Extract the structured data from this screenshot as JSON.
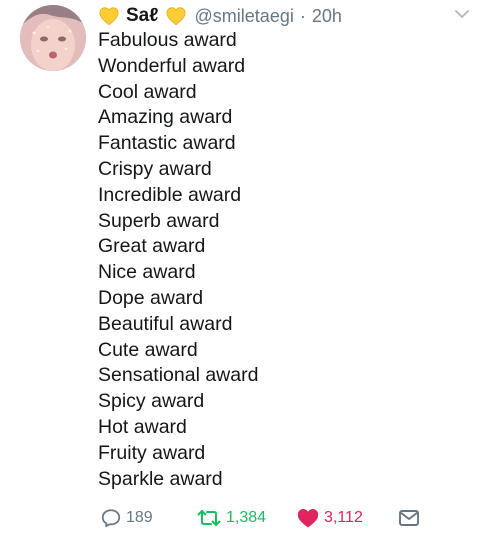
{
  "tweet": {
    "display_name": "Saℓ",
    "handle": "@smiletaegi",
    "separator": "·",
    "time": "20h",
    "lines": [
      "Fabulous award",
      "Wonderful award",
      "Cool award",
      "Amazing award",
      "Fantastic award",
      "Crispy award",
      "Incredible award",
      "Superb award",
      "Great award",
      "Nice award",
      "Dope award",
      "Beautiful award",
      "Cute award",
      "Sensational award",
      "Spicy award",
      "Hot award",
      "Fruity award",
      "Sparkle award"
    ]
  },
  "actions": {
    "replies": "189",
    "retweets": "1,384",
    "likes": "3,112"
  },
  "icons": {
    "name_emoji": "yellow-heart-icon",
    "menu": "chevron-down-icon",
    "reply": "reply-icon",
    "retweet": "retweet-icon",
    "like": "heart-icon",
    "dm": "envelope-icon"
  },
  "colors": {
    "text": "#14171a",
    "muted": "#657786",
    "retweet": "#17bf63",
    "like": "#e0245e",
    "yellow_heart": "#ffcc33"
  }
}
